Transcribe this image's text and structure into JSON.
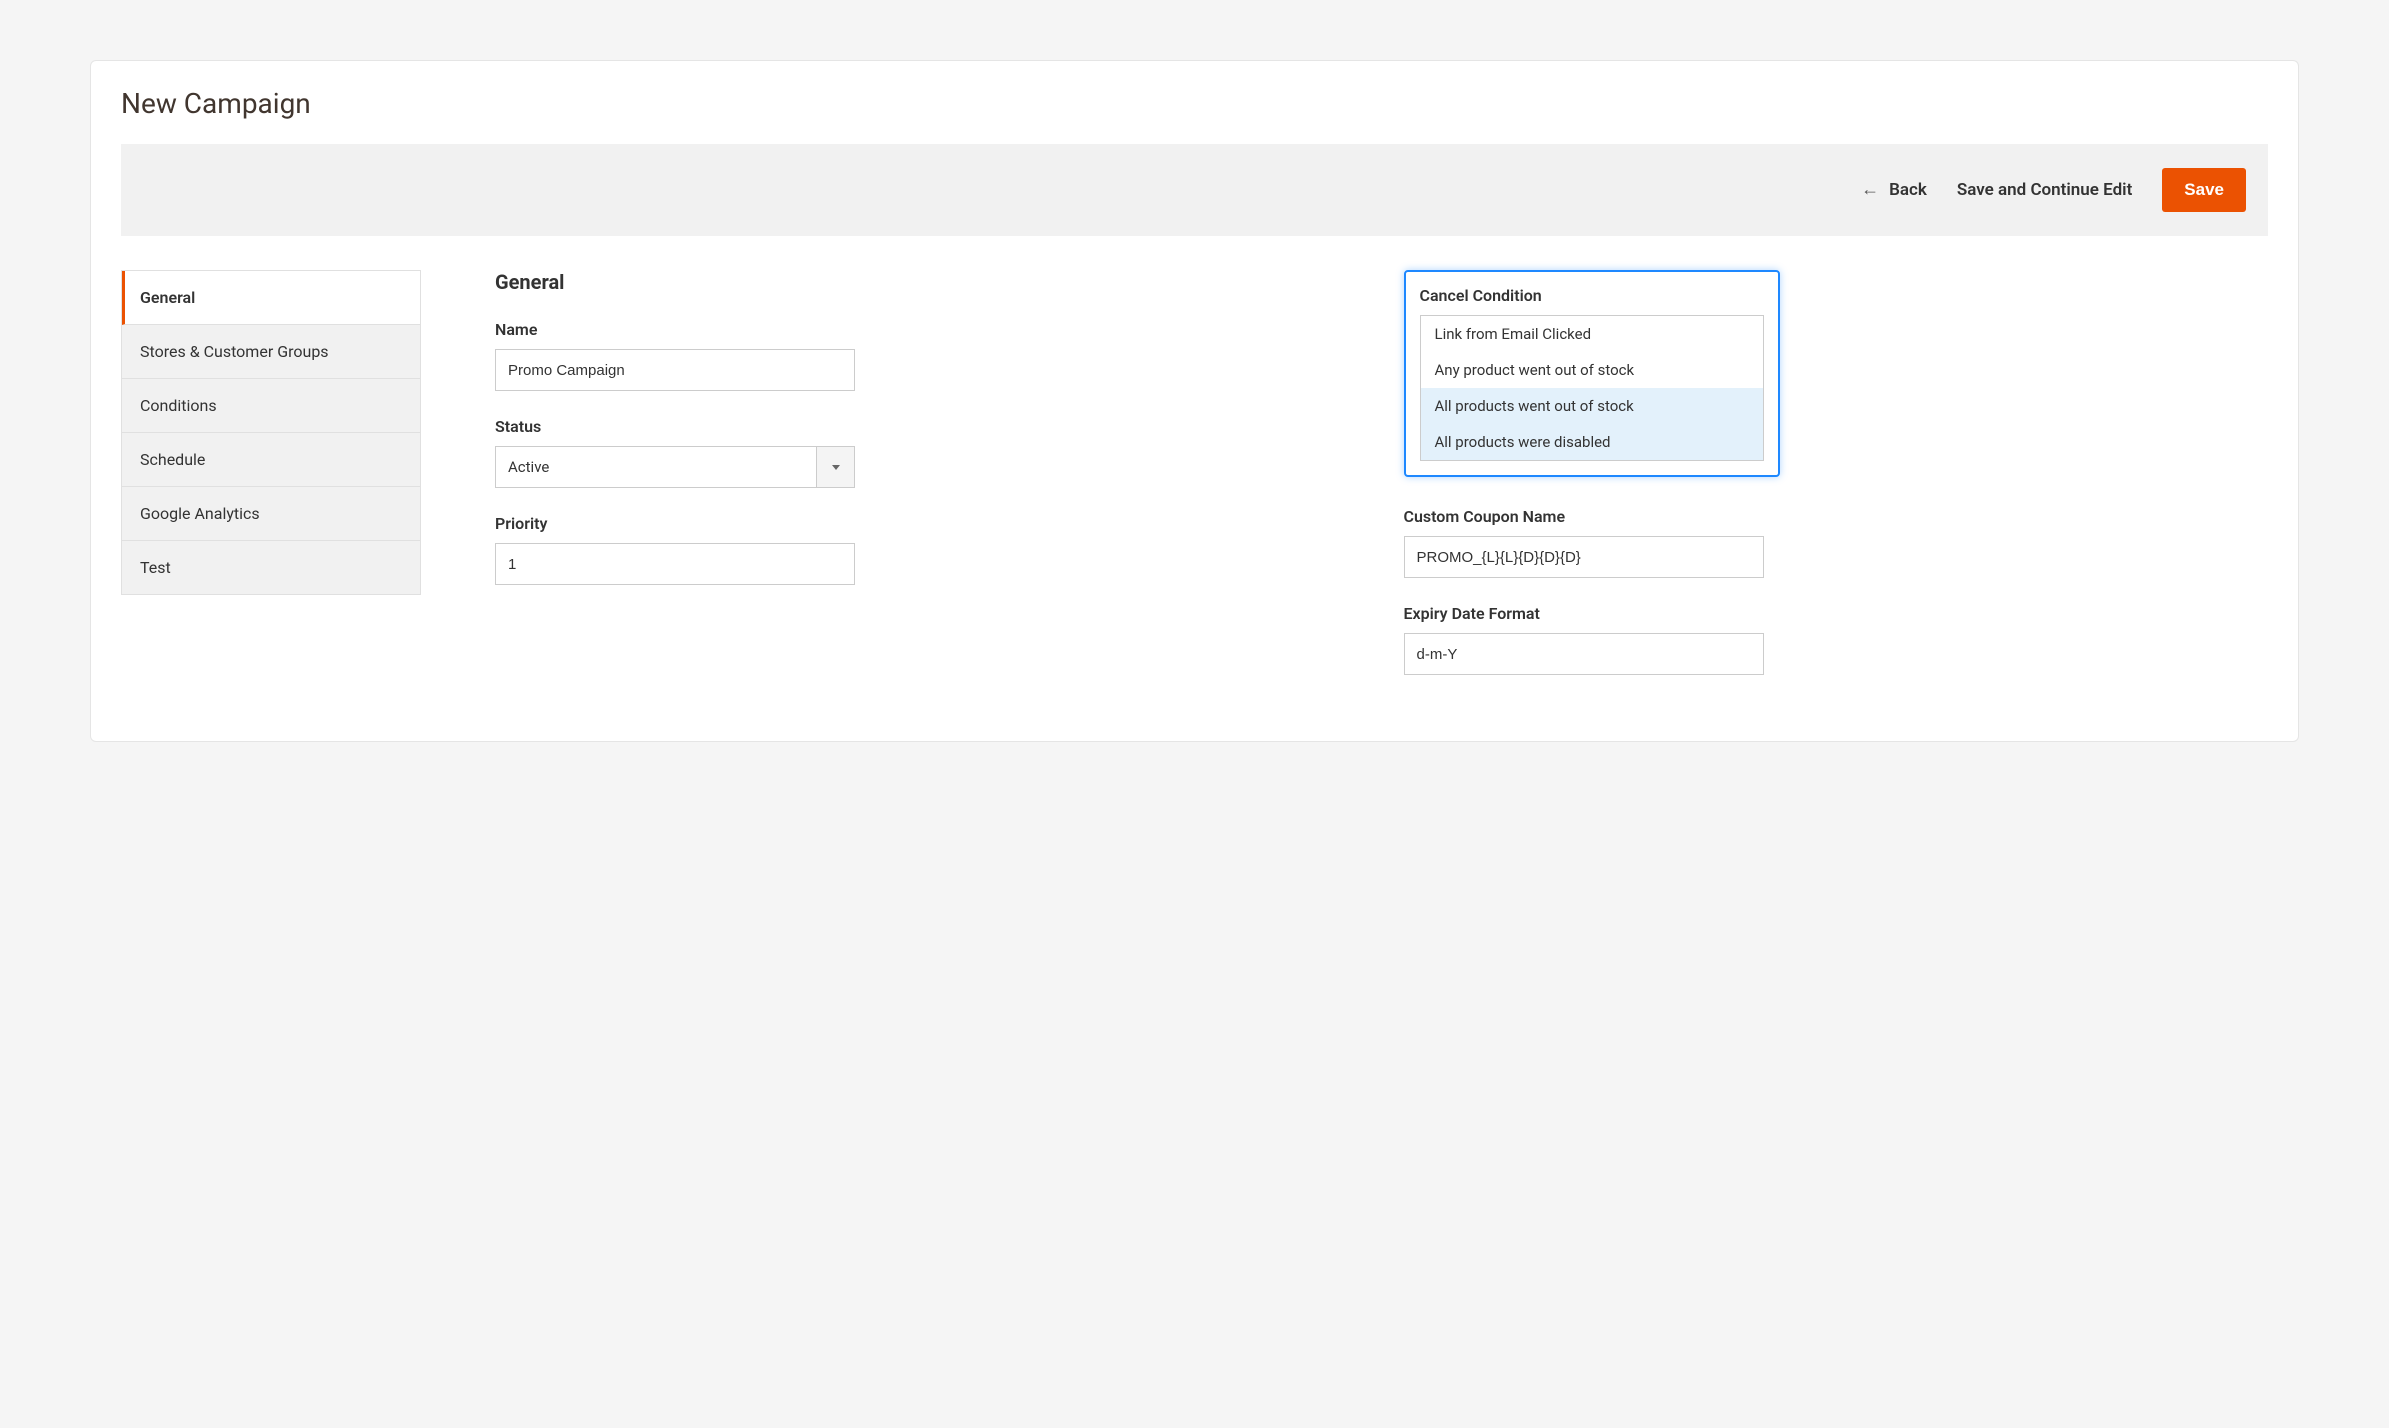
{
  "page": {
    "title": "New Campaign"
  },
  "toolbar": {
    "back_label": "Back",
    "save_continue_label": "Save and Continue Edit",
    "save_label": "Save"
  },
  "sidebar": {
    "items": [
      {
        "label": "General",
        "active": true
      },
      {
        "label": "Stores & Customer Groups",
        "active": false
      },
      {
        "label": "Conditions",
        "active": false
      },
      {
        "label": "Schedule",
        "active": false
      },
      {
        "label": "Google Analytics",
        "active": false
      },
      {
        "label": "Test",
        "active": false
      }
    ]
  },
  "section": {
    "title": "General"
  },
  "fields": {
    "name": {
      "label": "Name",
      "value": "Promo Campaign"
    },
    "status": {
      "label": "Status",
      "value": "Active"
    },
    "priority": {
      "label": "Priority",
      "value": "1"
    },
    "cancel_condition": {
      "label": "Cancel Condition",
      "options": [
        {
          "label": "Link from Email Clicked",
          "selected": false
        },
        {
          "label": "Any product went out of stock",
          "selected": false
        },
        {
          "label": "All products went out of stock",
          "selected": true
        },
        {
          "label": "All products were disabled",
          "selected": true
        }
      ]
    },
    "custom_coupon_name": {
      "label": "Custom Coupon Name",
      "value": "PROMO_{L}{L}{D}{D}{D}"
    },
    "expiry_date_format": {
      "label": "Expiry Date Format",
      "value": "d-m-Y"
    }
  },
  "colors": {
    "accent": "#eb5202",
    "highlight": "#1e88ff"
  }
}
